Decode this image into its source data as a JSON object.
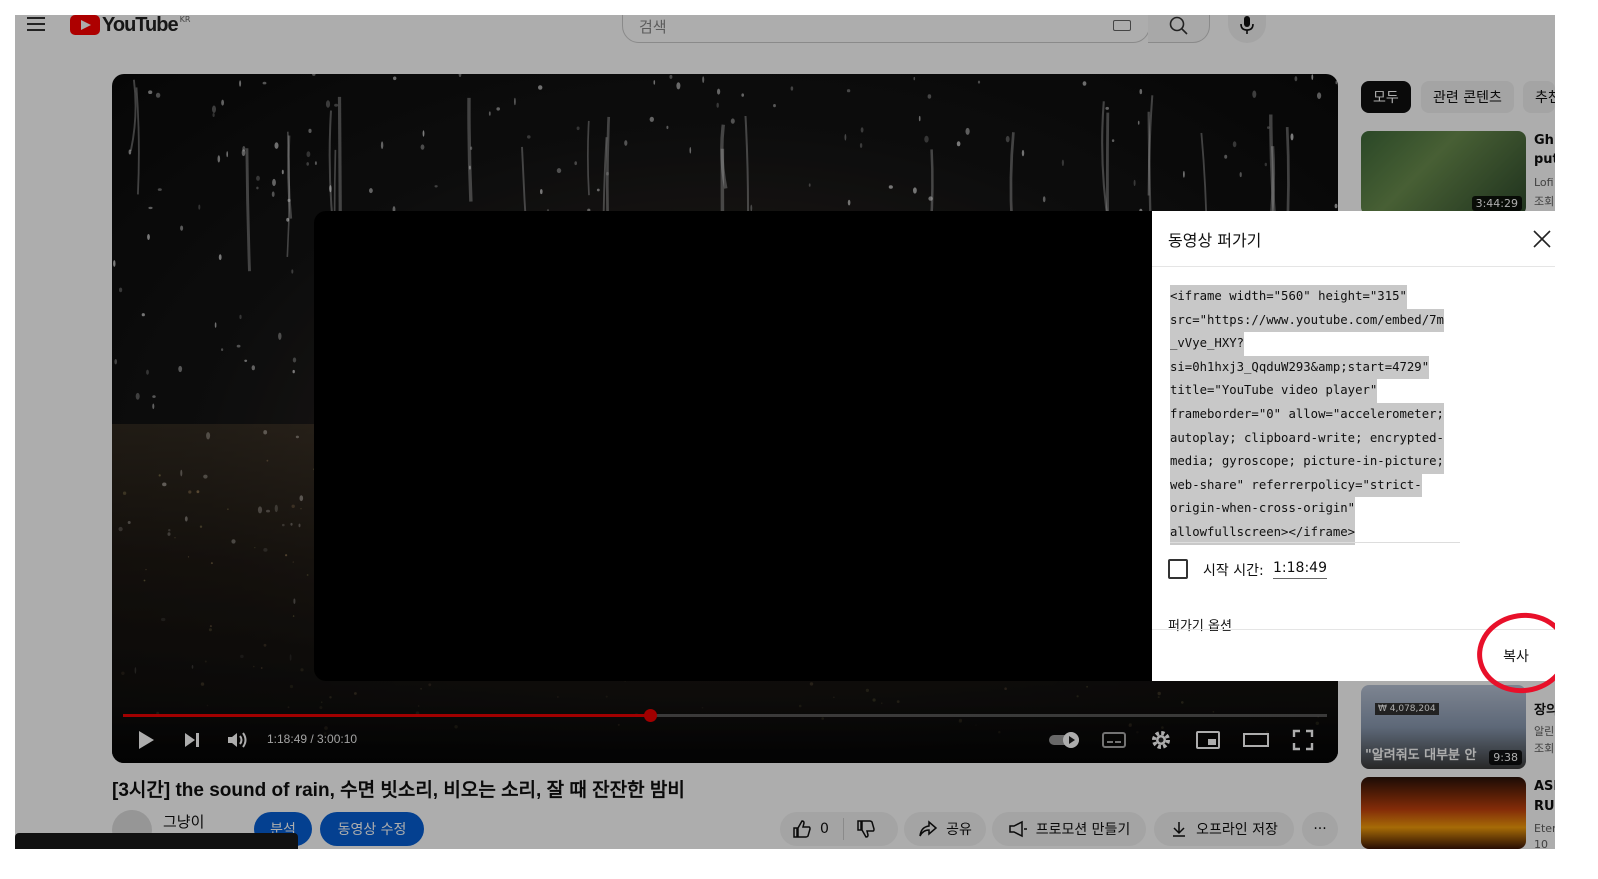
{
  "header": {
    "logo_text": "YouTube",
    "logo_region": "KR",
    "search_placeholder": "검색"
  },
  "player": {
    "current_time": "1:18:49",
    "duration": "3:00:10",
    "time_text": "1:18:49 / 3:00:10",
    "progress_fraction": 0.4376
  },
  "video": {
    "title": "[3시간] the sound of rain, 수면 빗소리, 비오는 소리, 잘 때 잔잔한 밤비",
    "channel_name": "그냥이",
    "analytics_label": "분석",
    "edit_label": "동영상 수정",
    "like_count": "0",
    "share_label": "공유",
    "promote_label": "프로모션 만들기",
    "download_label": "오프라인 저장",
    "more_label": "···"
  },
  "sidebar": {
    "chips": [
      "모두",
      "관련 콘텐츠",
      "추천"
    ],
    "items": [
      {
        "title": "Ghi",
        "title2": "put",
        "sub1": "Lofi",
        "sub2": "조회",
        "duration": "3:44:29"
      },
      {
        "title": "장의",
        "sub1": "알린",
        "sub2": "조회",
        "duration": "9:38",
        "thumb_caption": "\"알려줘도 대부분 안",
        "thumb_badge": "₩ 4,078,204"
      },
      {
        "title": "ASI",
        "title2": "RU:",
        "sub1": "Eter",
        "sub2": "10"
      }
    ]
  },
  "embed_modal": {
    "title": "동영상 퍼가기",
    "code_lines": [
      "<iframe width=\"560\" height=\"315\"",
      "src=\"https://www.youtube.com/embed/7m",
      "_vVye_HXY?",
      "si=0h1hxj3_QqduW293&amp;start=4729\"",
      "title=\"YouTube video player\"",
      "frameborder=\"0\" allow=\"accelerometer;",
      "autoplay; clipboard-write; encrypted-",
      "media; gyroscope; picture-in-picture;",
      "web-share\" referrerpolicy=\"strict-",
      "origin-when-cross-origin\"",
      "allowfullscreen></iframe>"
    ],
    "start_time_label": "시작 시간:",
    "start_time_value": "1:18:49",
    "options_label": "퍼가기 옵션",
    "copy_label": "복사"
  },
  "colors": {
    "accent_red": "#ff0000",
    "progress_red": "#e00000",
    "annotation_red": "#e8102a",
    "blue_button": "#065fd4"
  }
}
